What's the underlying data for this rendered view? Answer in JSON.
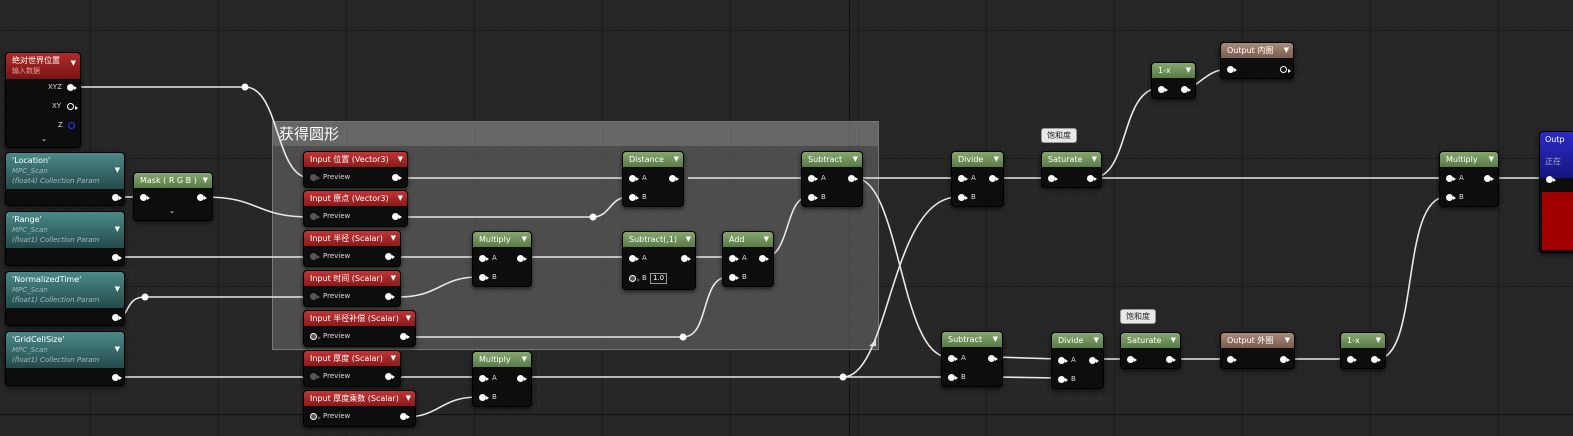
{
  "comment": {
    "title": "获得圆形"
  },
  "world_pos": {
    "title": "绝对世界位置",
    "subtitle": "输入数据",
    "outputs": [
      "XYZ",
      "XY",
      "Z"
    ]
  },
  "params": [
    {
      "name": "'Location'",
      "collection": "MPC_Scan",
      "type": "(float4) Collection Param"
    },
    {
      "name": "'Range'",
      "collection": "MPC_Scan",
      "type": "(float1) Collection Param"
    },
    {
      "name": "'NormalizedTime'",
      "collection": "MPC_Scan",
      "type": "(float1) Collection Param"
    },
    {
      "name": "'GridCellSize'",
      "collection": "MPC_Scan",
      "type": "(float1) Collection Param"
    }
  ],
  "mask": {
    "title": "Mask ( R G B )"
  },
  "inputs": [
    {
      "title": "Input 位置 (Vector3)",
      "pin": "Preview"
    },
    {
      "title": "Input 原点 (Vector3)",
      "pin": "Preview"
    },
    {
      "title": "Input 半径 (Scalar)",
      "pin": "Preview"
    },
    {
      "title": "Input 时间 (Scalar)",
      "pin": "Preview"
    },
    {
      "title": "Input 半径补偿 (Scalar)",
      "pin": "Preview"
    },
    {
      "title": "Input 厚度 (Scalar)",
      "pin": "Preview"
    },
    {
      "title": "Input 厚度乘数 (Scalar)",
      "pin": "Preview"
    }
  ],
  "nodes": {
    "distance": {
      "title": "Distance",
      "a": "A",
      "b": "B"
    },
    "multiply1": {
      "title": "Multiply",
      "a": "A",
      "b": "B"
    },
    "subtract1": {
      "title": "Subtract(,1)",
      "a": "A",
      "b": "B",
      "b_value": "1.0"
    },
    "add": {
      "title": "Add",
      "a": "A",
      "b": "B"
    },
    "subtract_main": {
      "title": "Subtract",
      "a": "A",
      "b": "B"
    },
    "multiply2": {
      "title": "Multiply",
      "a": "A",
      "b": "B"
    },
    "divide1": {
      "title": "Divide",
      "a": "A",
      "b": "B"
    },
    "saturate1": {
      "title": "Saturate"
    },
    "one_minus_top": {
      "title": "1-x"
    },
    "output_inner": {
      "title": "Output 内圈"
    },
    "subtract2": {
      "title": "Subtract",
      "a": "A",
      "b": "B"
    },
    "divide2": {
      "title": "Divide",
      "a": "A",
      "b": "B"
    },
    "saturate2": {
      "title": "Saturate"
    },
    "output_outer": {
      "title": "Output 外圈"
    },
    "one_minus_bottom": {
      "title": "1-x"
    },
    "multiply_final": {
      "title": "Multiply",
      "a": "A",
      "b": "B"
    },
    "partial_output": {
      "title": "Outp",
      "subtitle": "正在"
    }
  },
  "tags": {
    "saturate1": "饱和度",
    "saturate2": "饱和度"
  },
  "colors": {
    "background": "#262626",
    "input_header": "#b02a2a",
    "math_header": "#6e9058",
    "param_header": "#356a6a",
    "output_header": "#94746a"
  }
}
